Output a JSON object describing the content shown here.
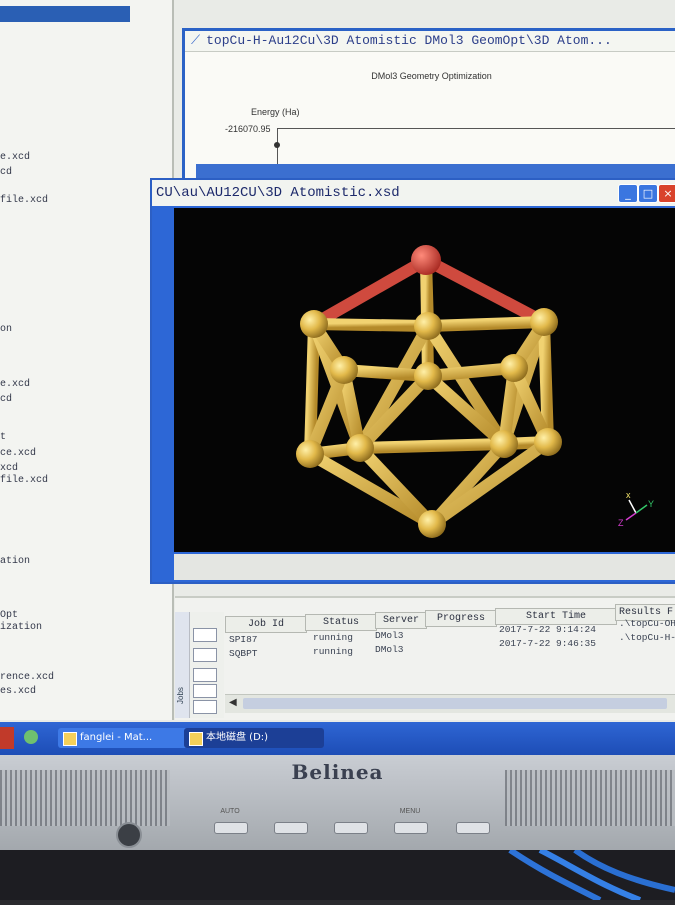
{
  "left_pane": {
    "items": [
      "e.xcd",
      "cd",
      "file.xcd",
      "on",
      "e.xcd",
      "cd",
      "t",
      "ce.xcd",
      "xcd",
      "file.xcd",
      "ation",
      "Opt",
      "ization",
      "rence.xcd",
      "es.xcd"
    ]
  },
  "graph_window": {
    "title": "topCu-H-Au12Cu\\3D Atomistic DMol3 GeomOpt\\3D Atom...",
    "chart_title": "DMol3 Geometry Optimization",
    "y_label": "Energy (Ha)",
    "y_value": "-216070.95"
  },
  "back_window": {
    "title_partial": "topCu-H-Au12Cu\\3D Atomistic DMol3 GeomOpt\\3D Atom..."
  },
  "molecule_window": {
    "title": "CU\\au\\AU12CU\\3D Atomistic.xsd",
    "buttons": {
      "minimize": "_",
      "maximize": "□",
      "close": "×"
    },
    "axes": {
      "x": "x",
      "y": "Y",
      "z": "Z"
    },
    "colors": {
      "gold": "#e2b94a",
      "copper": "#d8453c",
      "background": "#050505"
    }
  },
  "jobs_panel": {
    "side_label": "Jobs",
    "columns": [
      "Job Id",
      "Status",
      "Server",
      "Progress",
      "Start Time",
      "Results F"
    ],
    "rows": [
      {
        "job_id": "SPI87",
        "status": "running",
        "server": "DMol3",
        "progress": "",
        "start_time": "2017-7-22 9:14:24",
        "results": ".\\topCu-OH-"
      },
      {
        "job_id": "SQBPT",
        "status": "running",
        "server": "DMol3",
        "progress": "",
        "start_time": "2017-7-22 9:46:35",
        "results": ".\\topCu-H-A"
      }
    ]
  },
  "taskbar": {
    "items": [
      {
        "label": "fanglei - Mat..."
      },
      {
        "label": "本地磁盘 (D:)"
      }
    ]
  },
  "monitor": {
    "brand": "Belinea",
    "buttons": [
      "AUTO",
      "",
      "",
      "MENU",
      ""
    ]
  }
}
